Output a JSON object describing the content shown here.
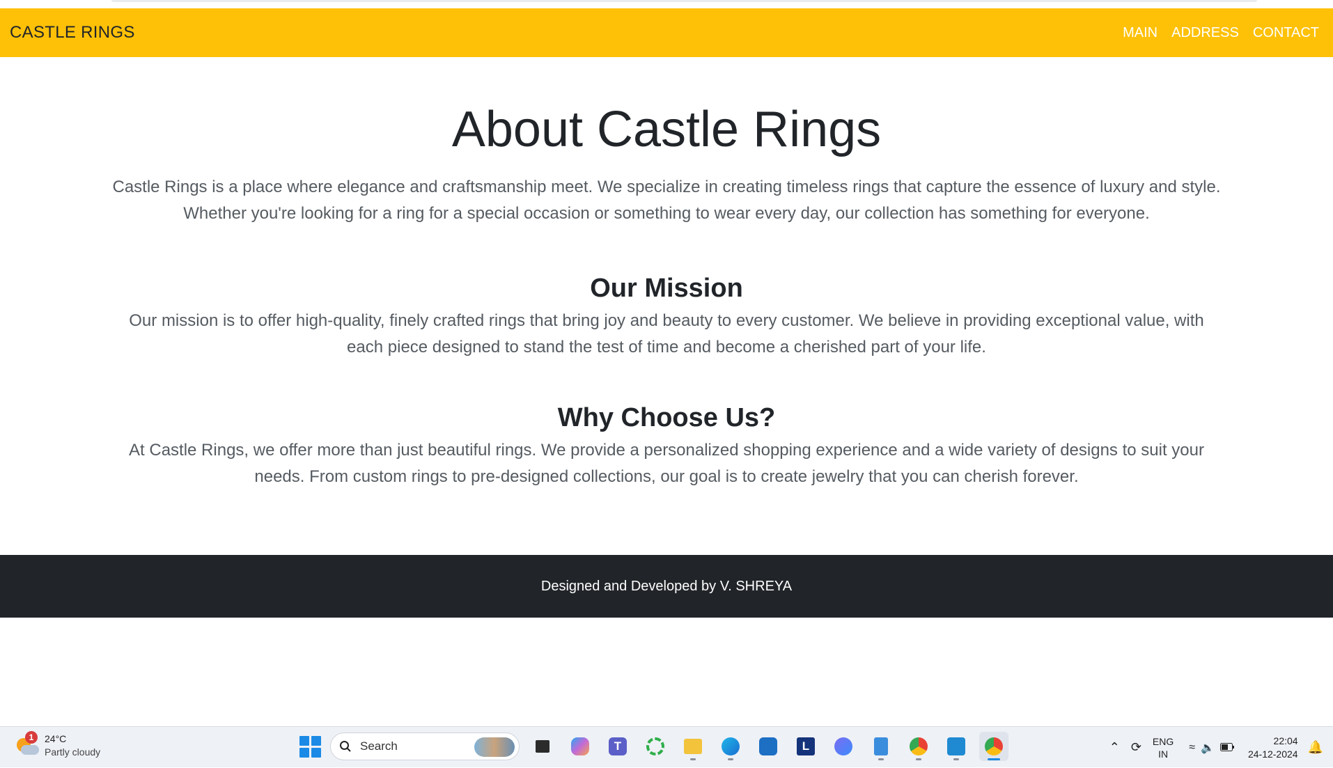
{
  "navbar": {
    "brand": "CASTLE RINGS",
    "links": [
      "MAIN",
      "ADDRESS",
      "CONTACT"
    ],
    "background": "#ffc107"
  },
  "about": {
    "title": "About Castle Rings",
    "intro": "Castle Rings is a place where elegance and craftsmanship meet. We specialize in creating timeless rings that capture the essence of luxury and style. Whether you're looking for a ring for a special occasion or something to wear every day, our collection has something for everyone.",
    "mission_heading": "Our Mission",
    "mission_text": "Our mission is to offer high-quality, finely crafted rings that bring joy and beauty to every customer. We believe in providing exceptional value, with each piece designed to stand the test of time and become a cherished part of your life.",
    "why_heading": "Why Choose Us?",
    "why_text": "At Castle Rings, we offer more than just beautiful rings. We provide a personalized shopping experience and a wide variety of designs to suit your needs. From custom rings to pre-designed collections, our goal is to create jewelry that you can cherish forever."
  },
  "footer": {
    "text": "Designed and Developed by V. SHREYA",
    "background": "#212529"
  },
  "taskbar": {
    "weather": {
      "temp": "24°C",
      "condition": "Partly cloudy",
      "badge": "1"
    },
    "search_placeholder": "Search",
    "apps": [
      {
        "icon": "task-view-icon"
      },
      {
        "icon": "copilot-icon"
      },
      {
        "icon": "teams-icon",
        "glyph": "T"
      },
      {
        "icon": "loading-ring-icon"
      },
      {
        "icon": "file-explorer-icon"
      },
      {
        "icon": "edge-icon"
      },
      {
        "icon": "microsoft-store-icon"
      },
      {
        "icon": "l-app-icon",
        "glyph": "L"
      },
      {
        "icon": "a-app-icon"
      },
      {
        "icon": "notepad-icon"
      },
      {
        "icon": "chrome-profile-icon"
      },
      {
        "icon": "vscode-icon"
      },
      {
        "icon": "chrome-icon"
      }
    ],
    "lang_top": "ENG",
    "lang_bottom": "IN",
    "time": "22:04",
    "date": "24-12-2024"
  }
}
